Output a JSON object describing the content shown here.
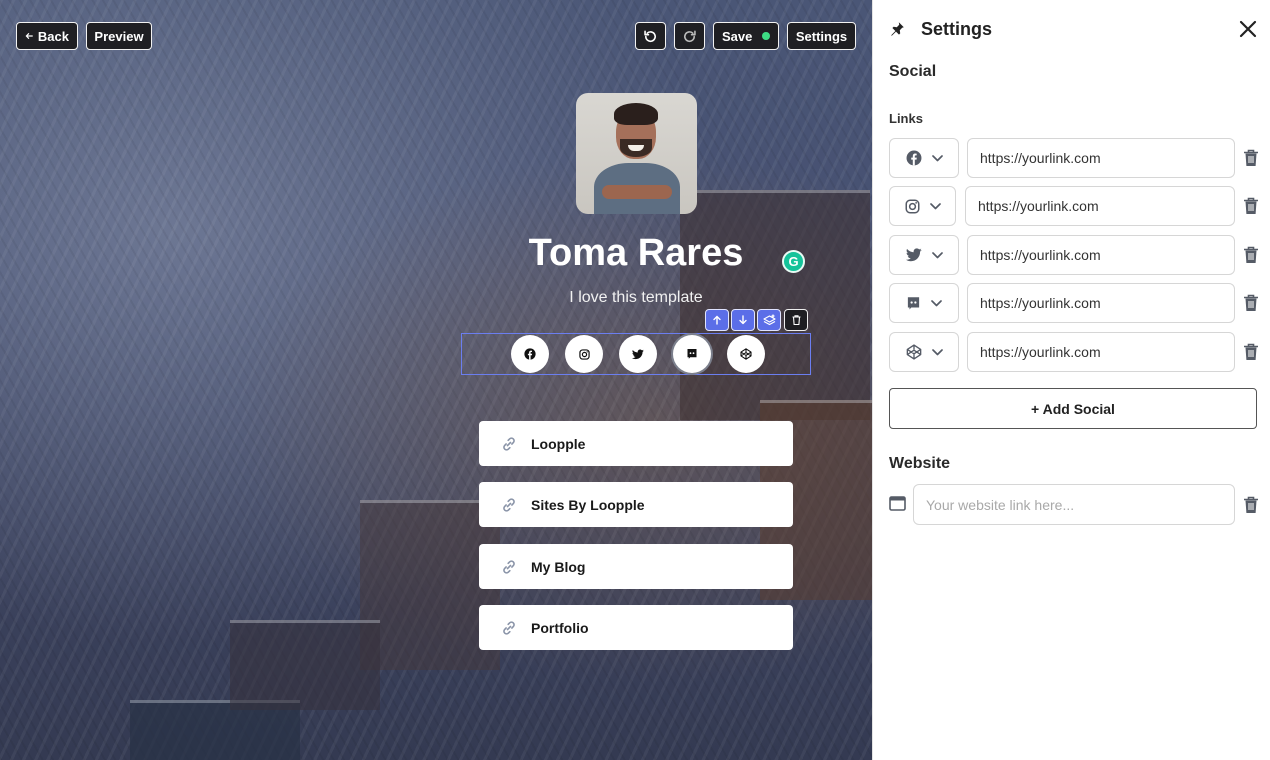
{
  "toolbar": {
    "back_label": "Back",
    "preview_label": "Preview",
    "save_label": "Save",
    "save_status_color": "#3ddc84",
    "settings_label": "Settings"
  },
  "profile": {
    "name": "Toma Rares",
    "bio": "I love this template"
  },
  "social_icons": [
    "facebook-icon",
    "instagram-icon",
    "twitter-icon",
    "discord-icon",
    "codepen-icon"
  ],
  "links": [
    {
      "label": "Loopple"
    },
    {
      "label": "Sites By Loopple"
    },
    {
      "label": "My Blog"
    },
    {
      "label": "Portfolio"
    }
  ],
  "panel": {
    "title": "Settings",
    "section_social": "Social",
    "links_label": "Links",
    "social_links": [
      {
        "platform": "facebook-icon",
        "url": "https://yourlink.com"
      },
      {
        "platform": "instagram-icon",
        "url": "https://yourlink.com"
      },
      {
        "platform": "twitter-icon",
        "url": "https://yourlink.com"
      },
      {
        "platform": "discord-icon",
        "url": "https://yourlink.com"
      },
      {
        "platform": "codepen-icon",
        "url": "https://yourlink.com"
      }
    ],
    "add_social_label": "+ Add Social",
    "section_website": "Website",
    "website_placeholder": "Your website link here...",
    "website_value": ""
  },
  "colors": {
    "accent": "#5b6ee8",
    "selection_border": "#6b7ef0",
    "panel_icon": "#555b66"
  }
}
